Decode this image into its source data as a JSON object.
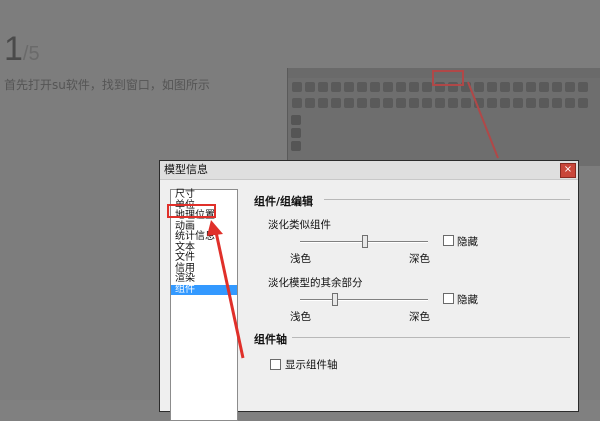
{
  "tutorial": {
    "step_current": "1",
    "step_total": "/5",
    "description": "首先打开su软件，找到窗口，如图所示"
  },
  "dialog": {
    "title": "模型信息",
    "close_glyph": "×",
    "list_items": [
      {
        "label": "尺寸",
        "selected": false
      },
      {
        "label": "单位",
        "selected": false
      },
      {
        "label": "地理位置",
        "selected": false
      },
      {
        "label": "动画",
        "selected": false
      },
      {
        "label": "统计信息",
        "selected": false
      },
      {
        "label": "文本",
        "selected": false
      },
      {
        "label": "文件",
        "selected": false
      },
      {
        "label": "信用",
        "selected": false
      },
      {
        "label": "渲染",
        "selected": false
      },
      {
        "label": "组件",
        "selected": true
      }
    ],
    "section_edit": "组件/组编辑",
    "fade_similar": "淡化类似组件",
    "fade_rest": "淡化模型的其余部分",
    "light_label": "浅色",
    "dark_label": "深色",
    "hide_label": "隐藏",
    "section_axes": "组件轴",
    "show_axes_label": "显示组件轴"
  },
  "annotation": {
    "color": "#e0302a"
  }
}
